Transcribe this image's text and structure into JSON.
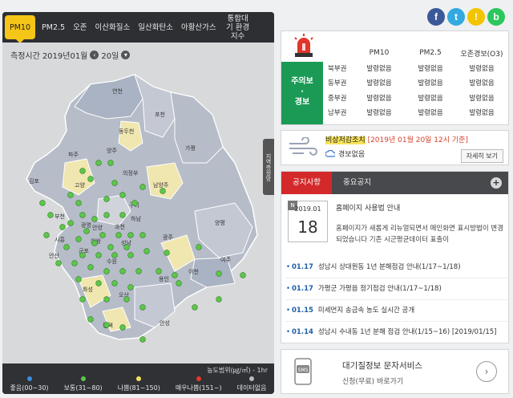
{
  "tabs": [
    {
      "label": "PM10",
      "active": true
    },
    {
      "label": "PM2.5"
    },
    {
      "label": "오존"
    },
    {
      "label": "이산화질소"
    },
    {
      "label": "일산화탄소"
    },
    {
      "label": "아황산가스"
    },
    {
      "label": "통합대기 환경지수"
    }
  ],
  "map": {
    "measure_label": "측정시간",
    "date": "2019년01월",
    "day": "20일",
    "prev_icon": "chevron-left-icon",
    "next_icon": "chevron-down-icon",
    "side_handle": "지역측정망",
    "region_labels": [
      "연천",
      "포천",
      "동두천",
      "가평",
      "양주",
      "파주",
      "의정부",
      "남양주",
      "김포",
      "고양",
      "구리",
      "하남",
      "양평",
      "부천",
      "광명",
      "안양",
      "과천",
      "성남",
      "광주",
      "시흥",
      "안산",
      "의왕",
      "군포",
      "수원",
      "용인",
      "이천",
      "여주",
      "화성",
      "오산",
      "평택",
      "안성",
      "서울",
      "인천"
    ]
  },
  "legend": {
    "unit": "농도범위(㎍/㎥) - 1hr",
    "items": [
      {
        "label": "좋음(00~30)",
        "color": "#3b8ee0"
      },
      {
        "label": "보통(31~80)",
        "color": "#5cc64a"
      },
      {
        "label": "나쁨(81~150)",
        "color": "#f1e25a"
      },
      {
        "label": "매우나쁨(151~)",
        "color": "#e03b2b"
      },
      {
        "label": "데이터없음",
        "color": "#bbbbbb"
      }
    ]
  },
  "social": [
    {
      "name": "facebook-icon",
      "glyph": "f",
      "color": "#3b5998"
    },
    {
      "name": "twitter-icon",
      "glyph": "t",
      "color": "#33a9e0"
    },
    {
      "name": "kakaostory-icon",
      "glyph": "!",
      "color": "#f2c500"
    },
    {
      "name": "band-icon",
      "glyph": "b",
      "color": "#2bc65c"
    }
  ],
  "alert": {
    "badge_line1": "주의보",
    "badge_dot": "·",
    "badge_line2": "경보",
    "headers": [
      "PM10",
      "PM2.5",
      "오존경보(O3)"
    ],
    "rows": [
      {
        "region": "북부권",
        "values": [
          "발령없음",
          "발령없음",
          "발령없음"
        ]
      },
      {
        "region": "동부권",
        "values": [
          "발령없음",
          "발령없음",
          "발령없음"
        ]
      },
      {
        "region": "중부권",
        "values": [
          "발령없음",
          "발령없음",
          "발령없음"
        ]
      },
      {
        "region": "남부권",
        "values": [
          "발령없음",
          "발령없음",
          "발령없음"
        ]
      }
    ]
  },
  "emergency": {
    "title": "비상저감조치",
    "time": "[2019년 01월 20일 12시 기준]",
    "status": "경보없음",
    "more": "자세히 보기"
  },
  "notice": {
    "tab_active": "공지사항",
    "tab_other": "중요공지",
    "plus": "+",
    "card_year_month": "2019.01",
    "card_day": "18",
    "card_new": "N",
    "featured_title": "홈페이지 사용법 안내",
    "featured_body": "홈페이지가 새롭게 리뉴얼되면서 메인화면 표시방법이 변경되었습니다 기존 시군평균데이터 표출이",
    "items": [
      {
        "date": "01.17",
        "text": "성남시 상대원동 1년 분해점검 안내(1/17~1/18)"
      },
      {
        "date": "01.17",
        "text": "가평군 가평읍 정기점검 안내(1/17~1/18)"
      },
      {
        "date": "01.15",
        "text": "미세먼지 송금속 농도 실시간 공개"
      },
      {
        "date": "01.14",
        "text": "성남시 수내동 1년 분해 점검 안내(1/15~16) [2019/01/15]"
      }
    ]
  },
  "sms": {
    "title": "대기질정보 문자서비스",
    "subtitle": "신청(무료) 바로가기",
    "icon_label": "SMS",
    "arrow": "›"
  }
}
